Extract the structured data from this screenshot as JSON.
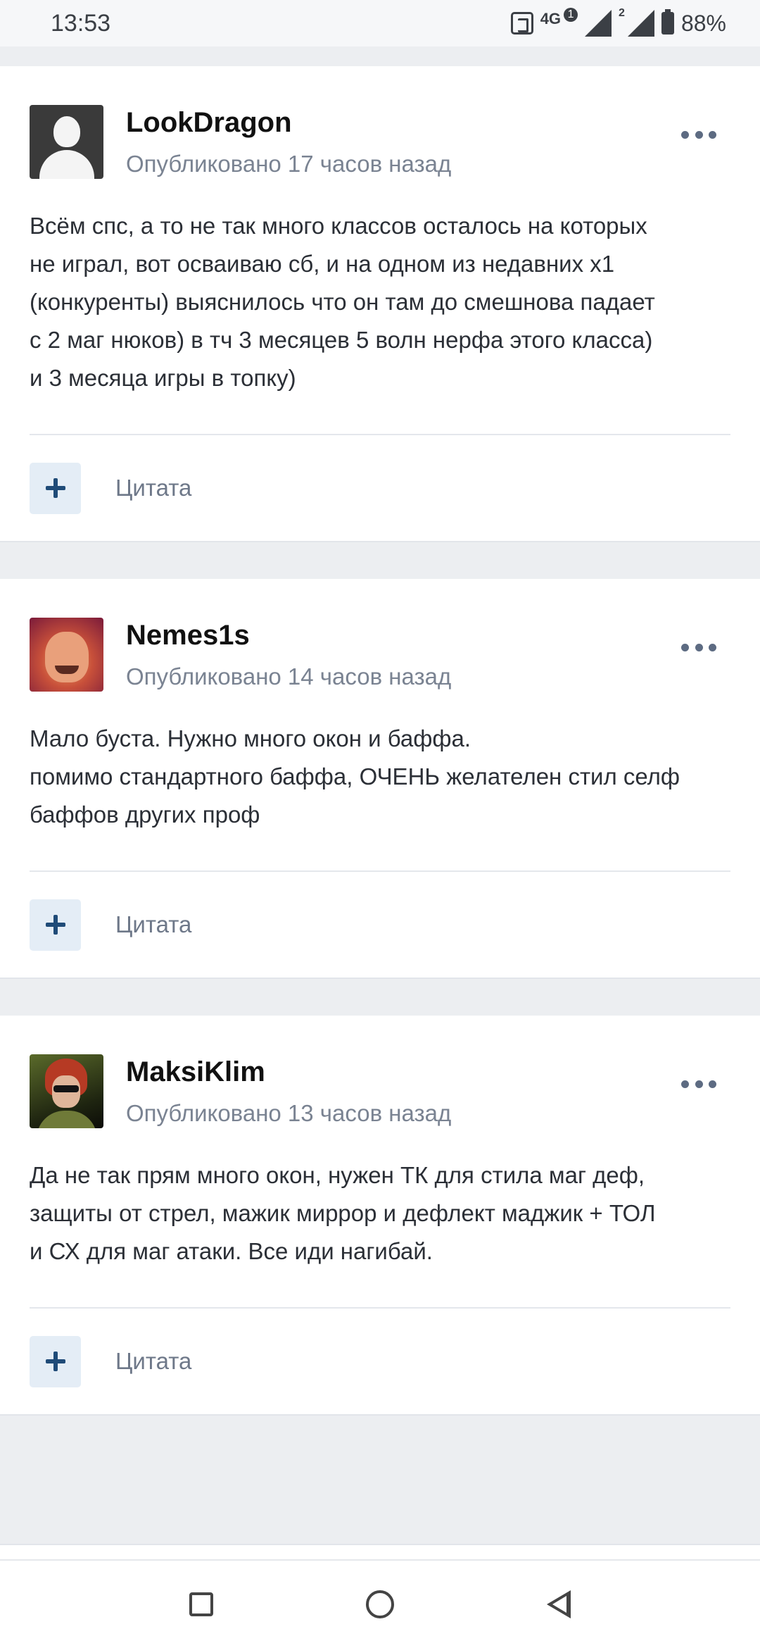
{
  "status_bar": {
    "time": "13:53",
    "network": "4G",
    "sim1_badge": "1",
    "sim2_label": "2",
    "battery": "88%"
  },
  "posts": [
    {
      "author": "LookDragon",
      "date": "Опубликовано 17 часов назад",
      "body": "Всём спс, а то не так много классов осталось на которых\nне играл, вот осваиваю сб, и на одном из недавних х1\n(конкуренты) выяснилось что он там до смешнова падает\nс 2 маг нюков) в тч 3 месяцев 5 волн нерфа этого класса)\nи 3 месяца игры в топку)",
      "quote_label": "Цитата"
    },
    {
      "author": "Nemes1s",
      "date": "Опубликовано 14 часов назад",
      "body": "Мало буста. Нужно много окон и баффа.\nпомимо стандартного баффа, ОЧЕНЬ желателен стил селф\nбаффов других проф",
      "quote_label": "Цитата"
    },
    {
      "author": "MaksiKlim",
      "date": "Опубликовано 13 часов назад",
      "body": "Да не так прям много окон, нужен ТК для стила маг деф,\nзащиты от стрел, мажик миррор и дефлект маджик + ТОЛ\nи СХ для маг атаки. Все иди нагибай.",
      "quote_label": "Цитата"
    }
  ],
  "icons": {
    "more": "more-dots-icon",
    "plus": "plus-icon",
    "nav_recents": "square-icon",
    "nav_home": "circle-icon",
    "nav_back": "triangle-back-icon"
  },
  "colors": {
    "link": "#1f4b78",
    "muted": "#7a8392",
    "background": "#eceef1"
  }
}
